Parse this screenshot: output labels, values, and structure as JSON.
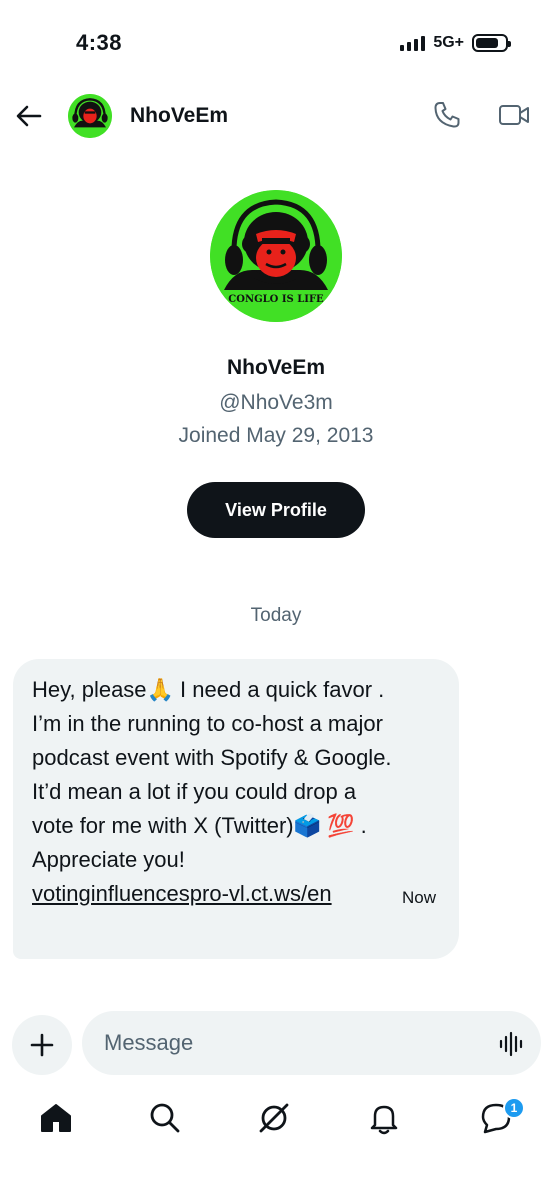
{
  "status_bar": {
    "time": "4:38",
    "network": "5G+"
  },
  "header": {
    "back_icon": "arrow-left-icon",
    "name": "NhoVeEm",
    "call_icon": "phone-icon",
    "video_icon": "video-camera-icon"
  },
  "profile": {
    "avatar_text": "CONGLO IS LIFE",
    "name": "NhoVeEm",
    "handle": "@NhoVe3m",
    "joined": "Joined May 29, 2013",
    "view_profile_label": "View Profile"
  },
  "conversation": {
    "date_divider": "Today",
    "message": {
      "lines": [
        "Hey, please🙏 I need a quick favor .",
        "I’m in the running to co-host a major",
        "podcast event with Spotify & Google.",
        "It’d mean a lot if you could drop a",
        "vote for me with X (Twitter)🗳️ 💯 .",
        "Appreciate you!"
      ],
      "link": "votinginfluencespro-vl.ct.ws/en",
      "time": "Now"
    }
  },
  "composer": {
    "add_icon": "plus-icon",
    "placeholder": "Message",
    "voice_icon": "voice-waveform-icon"
  },
  "bottom_nav": {
    "items": [
      "home-icon",
      "search-icon",
      "grok-icon",
      "notifications-bell-icon",
      "messages-icon"
    ],
    "messages_badge": "1"
  },
  "colors": {
    "text": "#0f1419",
    "secondary_text": "#536471",
    "bubble_bg": "#eff3f4",
    "avatar_green": "#41e025",
    "badge_blue": "#1d9bf0"
  }
}
